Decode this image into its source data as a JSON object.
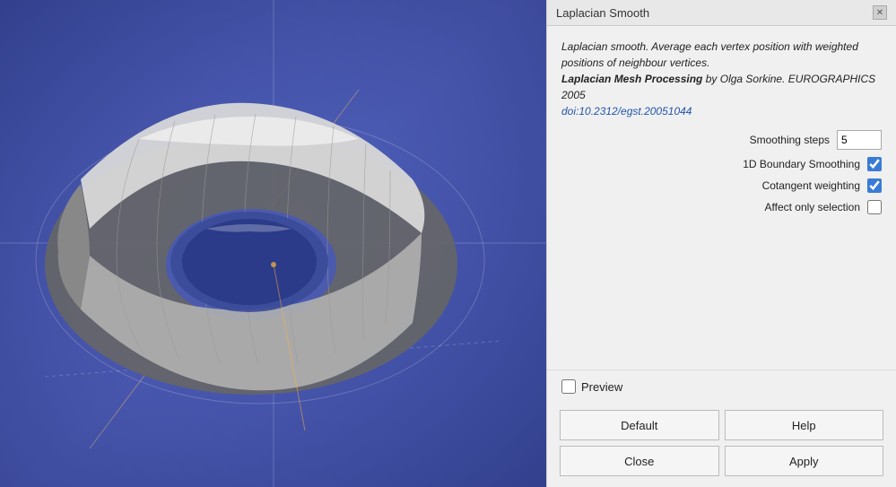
{
  "dialog": {
    "title": "Laplacian Smooth",
    "close_label": "✕",
    "description_line1": "Laplacian smooth. Average each vertex position with weighted positions of neighbour vertices.",
    "description_bold": "Laplacian Mesh Processing",
    "description_author": " by Olga Sorkine. EUROGRAPHICS 2005",
    "description_link": "doi:10.2312/egst.20051044",
    "params": {
      "smoothing_steps_label": "Smoothing steps",
      "smoothing_steps_value": "5",
      "boundary_smoothing_label": "1D Boundary Smoothing",
      "boundary_smoothing_checked": true,
      "cotangent_weighting_label": "Cotangent weighting",
      "cotangent_weighting_checked": true,
      "affect_only_selection_label": "Affect only selection",
      "affect_only_selection_checked": false
    },
    "preview_label": "Preview",
    "preview_checked": false,
    "buttons": {
      "default_label": "Default",
      "help_label": "Help",
      "close_label": "Close",
      "apply_label": "Apply"
    }
  }
}
